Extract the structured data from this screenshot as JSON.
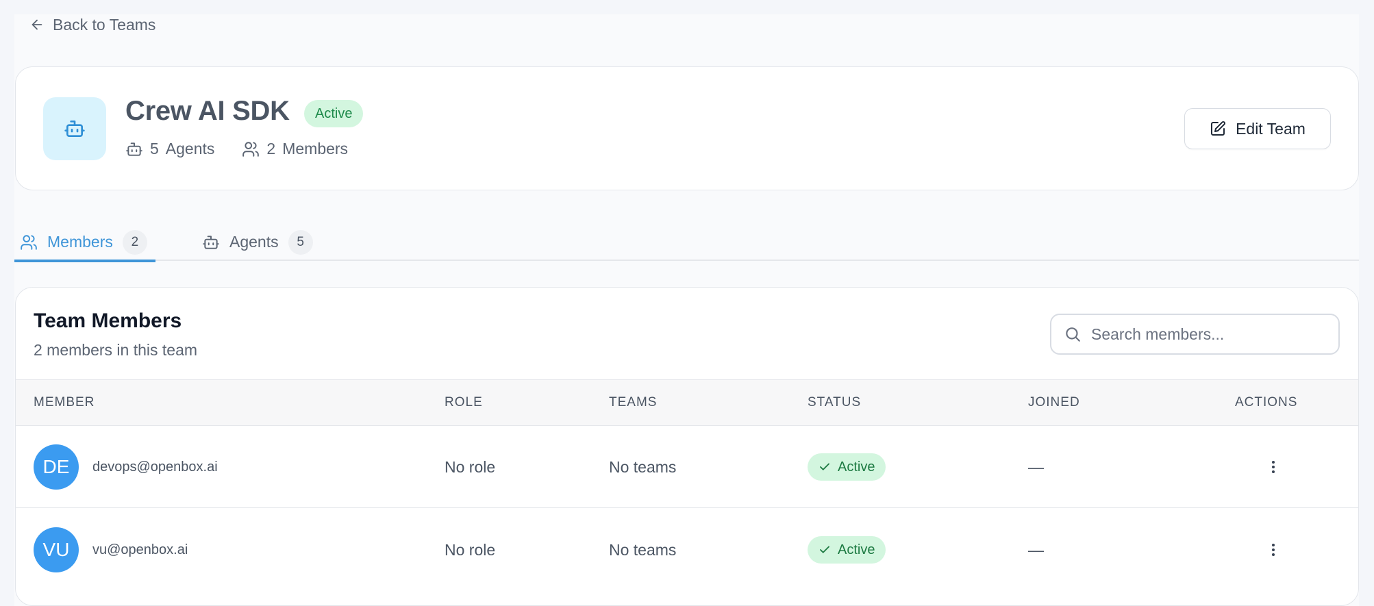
{
  "nav": {
    "back_label": "Back to Teams"
  },
  "team": {
    "name": "Crew AI SDK",
    "status": "Active",
    "agents_count": "5",
    "agents_label": "Agents",
    "members_count": "2",
    "members_label": "Members",
    "edit_label": "Edit Team",
    "avatar_icon": "bot-icon"
  },
  "tabs": [
    {
      "label": "Members",
      "count": "2",
      "icon": "users-icon",
      "active": true
    },
    {
      "label": "Agents",
      "count": "5",
      "icon": "bot-icon",
      "active": false
    }
  ],
  "members_panel": {
    "title": "Team Members",
    "subtitle": "2 members in this team",
    "search_placeholder": "Search members..."
  },
  "table": {
    "headers": [
      "MEMBER",
      "ROLE",
      "TEAMS",
      "STATUS",
      "JOINED",
      "ACTIONS"
    ],
    "rows": [
      {
        "initials": "DE",
        "email": "devops@openbox.ai",
        "role": "No role",
        "teams": "No teams",
        "status": "Active",
        "joined": "—"
      },
      {
        "initials": "VU",
        "email": "vu@openbox.ai",
        "role": "No role",
        "teams": "No teams",
        "status": "Active",
        "joined": "—"
      }
    ]
  },
  "colors": {
    "accent": "#3f95d8",
    "status_bg": "#d3f6df",
    "status_text": "#1d8a4a",
    "avatar": "#3b9bf0"
  }
}
